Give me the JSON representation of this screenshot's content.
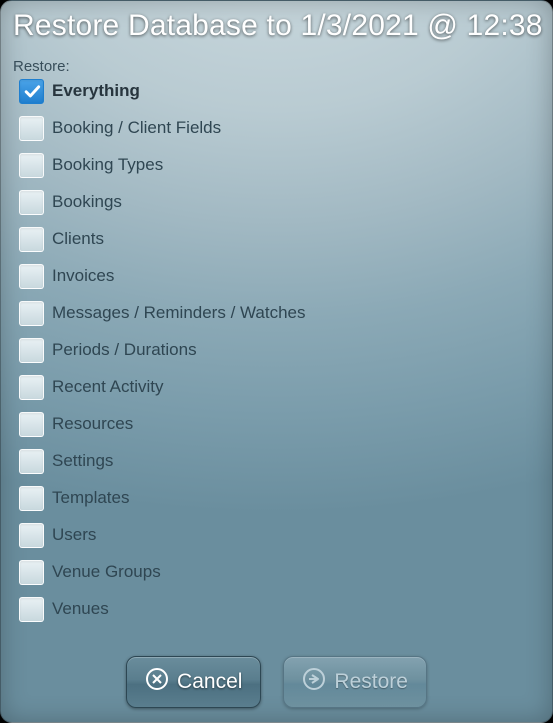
{
  "title": "Restore Database to 1/3/2021 @ 12:38",
  "restore_label": "Restore:",
  "options": [
    {
      "label": "Everything",
      "checked": true,
      "bold": true
    },
    {
      "label": "Booking / Client Fields",
      "checked": false,
      "bold": false
    },
    {
      "label": "Booking Types",
      "checked": false,
      "bold": false
    },
    {
      "label": "Bookings",
      "checked": false,
      "bold": false
    },
    {
      "label": "Clients",
      "checked": false,
      "bold": false
    },
    {
      "label": "Invoices",
      "checked": false,
      "bold": false
    },
    {
      "label": "Messages / Reminders / Watches",
      "checked": false,
      "bold": false
    },
    {
      "label": "Periods / Durations",
      "checked": false,
      "bold": false
    },
    {
      "label": "Recent Activity",
      "checked": false,
      "bold": false
    },
    {
      "label": "Resources",
      "checked": false,
      "bold": false
    },
    {
      "label": "Settings",
      "checked": false,
      "bold": false
    },
    {
      "label": "Templates",
      "checked": false,
      "bold": false
    },
    {
      "label": "Users",
      "checked": false,
      "bold": false
    },
    {
      "label": "Venue Groups",
      "checked": false,
      "bold": false
    },
    {
      "label": "Venues",
      "checked": false,
      "bold": false
    }
  ],
  "buttons": {
    "cancel": "Cancel",
    "restore": "Restore"
  }
}
